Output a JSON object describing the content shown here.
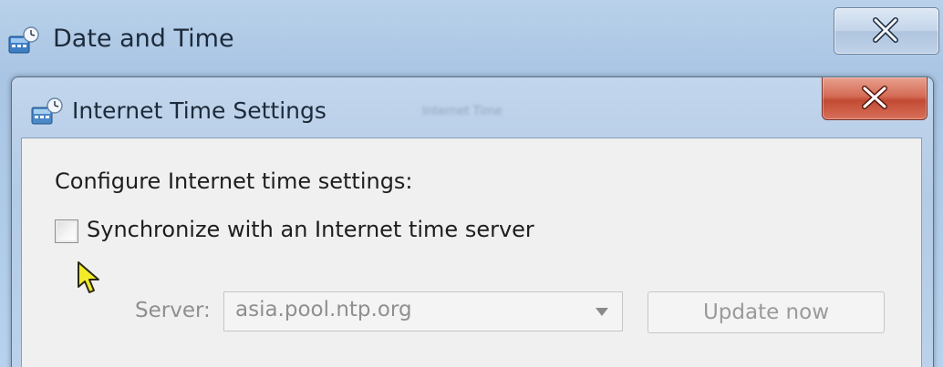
{
  "outer_window": {
    "title": "Date and Time",
    "icon": "clock-globe-icon",
    "close_glyph": "close-icon"
  },
  "inner_dialog": {
    "title": "Internet Time Settings",
    "icon": "clock-globe-icon",
    "background_tab_labels": [
      "Internet Time"
    ],
    "close_glyph": "close-icon"
  },
  "settings": {
    "heading": "Configure Internet time settings:",
    "sync_checkbox": {
      "label": "Synchronize with an Internet time server",
      "checked": false
    },
    "server": {
      "label": "Server:",
      "value": "asia.pool.ntp.org",
      "enabled": false
    },
    "update_button_label": "Update now"
  },
  "colors": {
    "close_red": "#c24a33",
    "titlebar_blue": "#b4cbe6",
    "disabled_text": "#8f8f8f",
    "cursor_yellow": "#f2ec2a"
  }
}
